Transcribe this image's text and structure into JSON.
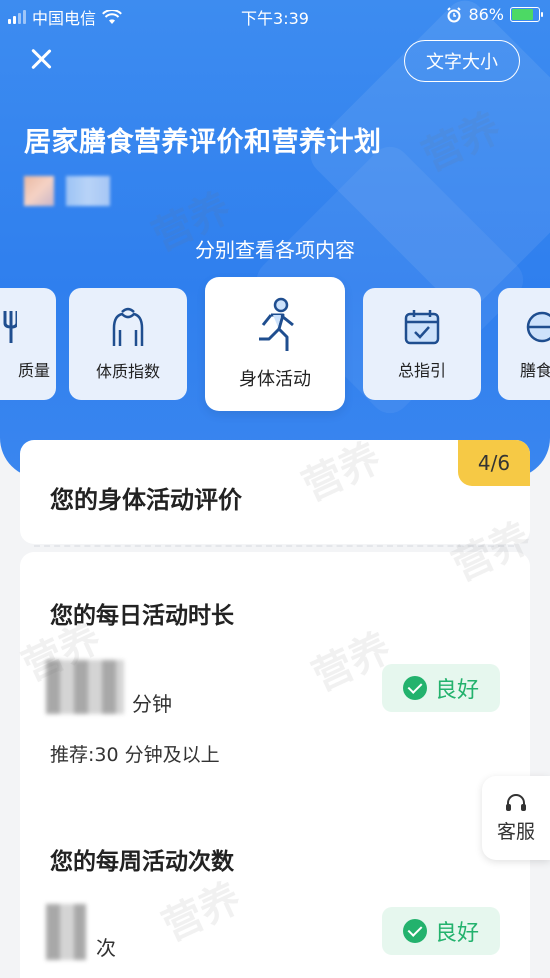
{
  "status_bar": {
    "carrier": "中国电信",
    "time": "下午3:39",
    "battery": "86%"
  },
  "header": {
    "text_size_label": "文字大小",
    "title": "居家膳食营养评价和营养计划",
    "subtitle": "分别查看各项内容"
  },
  "categories": [
    {
      "label": "质量",
      "icon": "fork-icon"
    },
    {
      "label": "体质指数",
      "icon": "body-icon"
    },
    {
      "label": "身体活动",
      "icon": "running-icon",
      "active": true
    },
    {
      "label": "总指引",
      "icon": "calendar-check-icon"
    },
    {
      "label": "膳食",
      "icon": "bowl-icon"
    }
  ],
  "evaluation": {
    "title": "您的身体活动评价",
    "page_indicator": "4/6"
  },
  "daily": {
    "title": "您的每日活动时长",
    "unit": "分钟",
    "rating": "良好",
    "recommendation": "推荐:30 分钟及以上"
  },
  "weekly": {
    "title": "您的每周活动次数",
    "unit": "次",
    "rating": "良好"
  },
  "service": {
    "label": "客服"
  },
  "watermark_text": "营养",
  "colors": {
    "header_blue": "#2f7fee",
    "good_green": "#23b26d",
    "badge_yellow": "#f6c945"
  }
}
